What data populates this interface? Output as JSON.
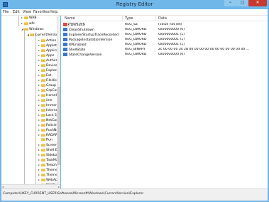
{
  "window": {
    "title": "Registry Editor",
    "controls": {
      "minimize": "–",
      "maximize": "□",
      "close": "✕"
    }
  },
  "menu": [
    "File",
    "Edit",
    "View",
    "Favorites",
    "Help"
  ],
  "tree": {
    "items": [
      {
        "label": "WAB",
        "expand": "▸"
      },
      {
        "label": "wfs",
        "expand": "▸"
      },
      {
        "label": "Windows",
        "expand": "◢"
      },
      {
        "label": "CurrentVersion",
        "expand": "◢"
      },
      {
        "label": "Action",
        "expand": "▸"
      },
      {
        "label": "Applets",
        "expand": "▸"
      },
      {
        "label": "Applica",
        "expand": "▸"
      },
      {
        "label": "Apps",
        "expand": "▸"
      },
      {
        "label": "Authen",
        "expand": "▸"
      },
      {
        "label": "Device",
        "expand": "▸"
      },
      {
        "label": "Explore",
        "expand": "▸"
      },
      {
        "label": "Ext",
        "expand": "▸"
      },
      {
        "label": "FileHist",
        "expand": "▸"
      },
      {
        "label": "Group",
        "expand": "▸"
      },
      {
        "label": "GrpCon",
        "expand": "▸"
      },
      {
        "label": "HomeG",
        "expand": "▸"
      },
      {
        "label": "ime",
        "expand": "▸"
      },
      {
        "label": "Immers",
        "expand": "▸"
      },
      {
        "label": "Interne",
        "expand": "▸"
      },
      {
        "label": "Lock Sc",
        "expand": "▸"
      },
      {
        "label": "NetCac",
        "expand": "▸"
      },
      {
        "label": "Policies",
        "expand": "▸"
      },
      {
        "label": "PushNo",
        "expand": "▸"
      },
      {
        "label": "RADAR",
        "expand": "▸"
      },
      {
        "label": "Run",
        "expand": ""
      },
      {
        "label": "Screens",
        "expand": "▸"
      },
      {
        "label": "Shell Ex",
        "expand": "▸"
      },
      {
        "label": "Sidebar",
        "expand": "▸"
      },
      {
        "label": "TaskMa",
        "expand": "▸"
      },
      {
        "label": "Telepho",
        "expand": "▸"
      },
      {
        "label": "Theme",
        "expand": "▸"
      },
      {
        "label": "Themes",
        "expand": "▸"
      },
      {
        "label": "WebAp",
        "expand": "▸"
      },
      {
        "label": "WinTru",
        "expand": "▸"
      }
    ],
    "hscroll": {
      "left": "◂",
      "right": "▸"
    }
  },
  "list": {
    "columns": [
      "Name",
      "Type",
      "Data"
    ],
    "rows": [
      {
        "name": "(Default)",
        "type": "REG_SZ",
        "data": "(value not set)",
        "icon": "string-value-icon"
      },
      {
        "name": "CleanShutdown",
        "type": "REG_DWORD",
        "data": "0x00000000 (0)",
        "icon": "binary-value-icon"
      },
      {
        "name": "ExplorerStartupTraceRecorded",
        "type": "REG_DWORD",
        "data": "0x00000001 (1)",
        "icon": "binary-value-icon"
      },
      {
        "name": "PackageInstallationVersion",
        "type": "REG_DWORD",
        "data": "0x00000001 (1)",
        "icon": "binary-value-icon"
      },
      {
        "name": "RPEnabled",
        "type": "REG_DWORD",
        "data": "0x00000001 (1)",
        "icon": "binary-value-icon"
      },
      {
        "name": "ShellState",
        "type": "REG_BINARY",
        "data": "2c 00 00 00 34 28 00 00 00 00 00 00 00 00 00 00 00 ...",
        "icon": "binary-value-icon"
      },
      {
        "name": "StateChangeVersion",
        "type": "REG_DWORD",
        "data": "0x00000000 (0)",
        "icon": "binary-value-icon"
      }
    ]
  },
  "status": {
    "path": "Computer\\HKEY_CURRENT_USER\\Software\\Microsoft\\Windows\\CurrentVersion\\Explorer"
  }
}
